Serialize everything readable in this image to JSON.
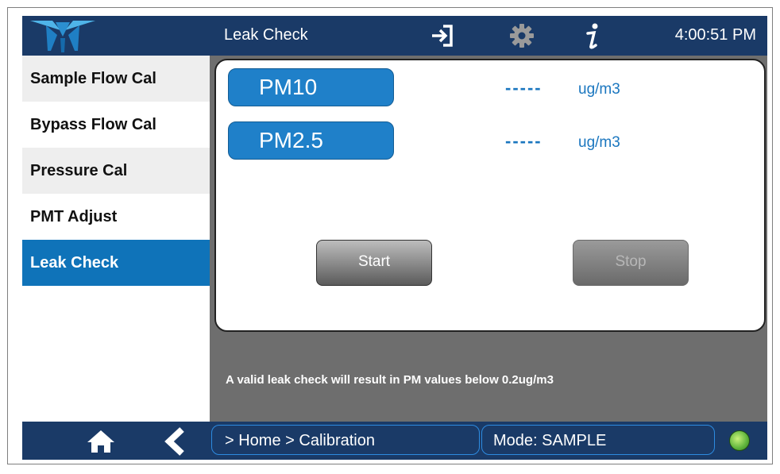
{
  "header": {
    "title": "Leak Check",
    "time": "4:00:51 PM"
  },
  "icons": [
    "logo-icon",
    "exit-icon",
    "gear-icon",
    "info-icon",
    "home-icon",
    "back-icon",
    "status-led-icon"
  ],
  "sidebar": {
    "items": [
      {
        "label": "Sample Flow Cal"
      },
      {
        "label": "Bypass Flow Cal"
      },
      {
        "label": "Pressure Cal"
      },
      {
        "label": "PMT Adjust"
      },
      {
        "label": "Leak Check",
        "active": true
      }
    ]
  },
  "main": {
    "readings": [
      {
        "label": "PM10",
        "value": "-----",
        "unit": "ug/m3"
      },
      {
        "label": "PM2.5",
        "value": "-----",
        "unit": "ug/m3"
      }
    ],
    "start_label": "Start",
    "stop_label": "Stop",
    "hint": "A valid leak check will result in PM values below 0.2ug/m3"
  },
  "footer": {
    "breadcrumb": "> Home > Calibration",
    "mode": "Mode: SAMPLE"
  },
  "colors": {
    "header_bg": "#1a3a67",
    "accent": "#0f73b9",
    "value_text": "#1a76bf",
    "status_led": "#5db33b"
  }
}
